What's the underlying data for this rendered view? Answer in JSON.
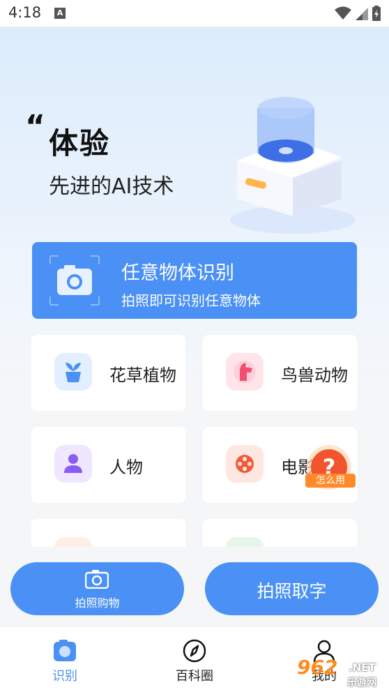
{
  "status_bar": {
    "time": "4:18",
    "notification_letter": "A"
  },
  "hero": {
    "quote_mark": "“",
    "title": "体验",
    "subtitle": "先进的AI技术"
  },
  "main_card": {
    "title": "任意物体识别",
    "subtitle": "拍照即可识别任意物体",
    "icon": "camera-scan-icon",
    "color": "#4a90f5"
  },
  "categories": [
    {
      "label": "花草植物",
      "icon": "plant-pot-icon",
      "color": "#4a90f5"
    },
    {
      "label": "鸟兽动物",
      "icon": "dog-icon",
      "color": "#f0506e"
    },
    {
      "label": "人物",
      "icon": "person-icon",
      "color": "#8a5cf0"
    },
    {
      "label": "电影",
      "icon": "film-reel-icon",
      "color": "#f25b3a"
    }
  ],
  "help_badge": {
    "symbol": "?",
    "label": "怎么用"
  },
  "bottom_buttons": {
    "shop_label": "拍照购物",
    "text_label": "拍照取字"
  },
  "tabbar": {
    "tabs": [
      {
        "label": "识别",
        "icon": "recognize-icon",
        "active": true
      },
      {
        "label": "百科圈",
        "icon": "compass-icon",
        "active": false
      },
      {
        "label": "我的",
        "icon": "profile-icon",
        "active": false
      }
    ]
  },
  "watermark": {
    "number": "962",
    "domain": ".NET",
    "site": "乐游网"
  }
}
